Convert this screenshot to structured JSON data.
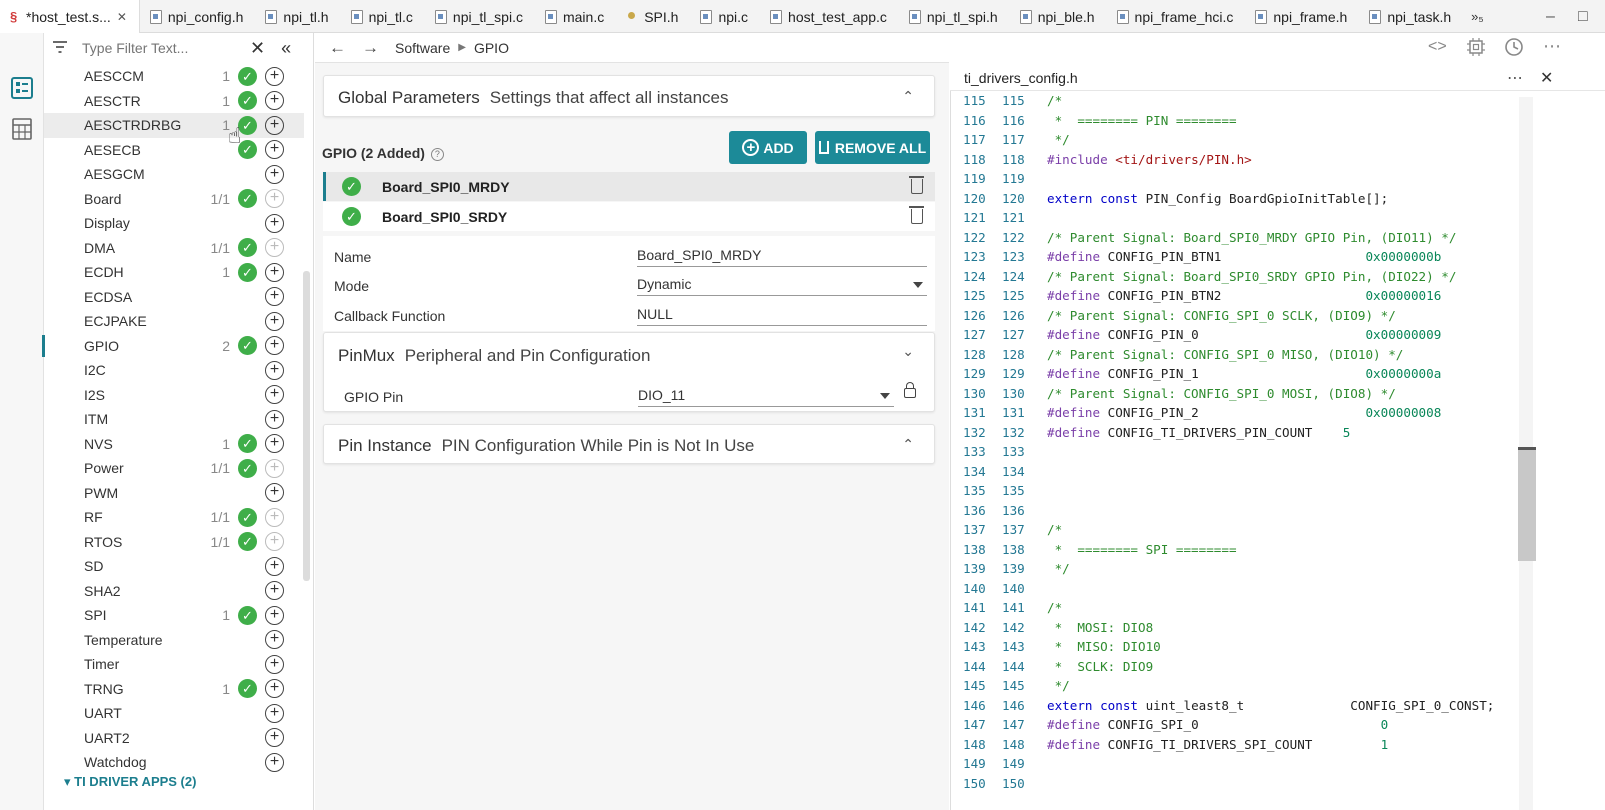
{
  "tabs": [
    {
      "label": "*host_test.s...",
      "icon": "sysconfig-icon",
      "active": true
    },
    {
      "label": "npi_config.h"
    },
    {
      "label": "npi_tl.h"
    },
    {
      "label": "npi_tl.c"
    },
    {
      "label": "npi_tl_spi.c"
    },
    {
      "label": "main.c"
    },
    {
      "label": "SPI.h"
    },
    {
      "label": "npi.c"
    },
    {
      "label": "host_test_app.c"
    },
    {
      "label": "npi_tl_spi.h"
    },
    {
      "label": "npi_ble.h"
    },
    {
      "label": "npi_frame_hci.c"
    },
    {
      "label": "npi_frame.h"
    },
    {
      "label": "npi_task.h"
    }
  ],
  "tab_overflow": "»₅",
  "filter": {
    "placeholder": "Type Filter Text..."
  },
  "modules": [
    {
      "name": "AESCCM",
      "count": "1",
      "added": true
    },
    {
      "name": "AESCTR",
      "count": "1",
      "added": true
    },
    {
      "name": "AESCTRDRBG",
      "count": "1",
      "added": true,
      "highlight": true
    },
    {
      "name": "AESECB",
      "count": "",
      "added": true
    },
    {
      "name": "AESGCM",
      "count": "",
      "added": false
    },
    {
      "name": "Board",
      "count": "1/1",
      "added": true,
      "plus_dim": true
    },
    {
      "name": "Display",
      "count": "",
      "added": false
    },
    {
      "name": "DMA",
      "count": "1/1",
      "added": true,
      "plus_dim": true
    },
    {
      "name": "ECDH",
      "count": "1",
      "added": true
    },
    {
      "name": "ECDSA",
      "count": "",
      "added": false
    },
    {
      "name": "ECJPAKE",
      "count": "",
      "added": false
    },
    {
      "name": "GPIO",
      "count": "2",
      "added": true,
      "selected": true
    },
    {
      "name": "I2C",
      "count": "",
      "added": false
    },
    {
      "name": "I2S",
      "count": "",
      "added": false
    },
    {
      "name": "ITM",
      "count": "",
      "added": false
    },
    {
      "name": "NVS",
      "count": "1",
      "added": true
    },
    {
      "name": "Power",
      "count": "1/1",
      "added": true,
      "plus_dim": true
    },
    {
      "name": "PWM",
      "count": "",
      "added": false
    },
    {
      "name": "RF",
      "count": "1/1",
      "added": true,
      "plus_dim": true
    },
    {
      "name": "RTOS",
      "count": "1/1",
      "added": true,
      "plus_dim": true
    },
    {
      "name": "SD",
      "count": "",
      "added": false
    },
    {
      "name": "SHA2",
      "count": "",
      "added": false
    },
    {
      "name": "SPI",
      "count": "1",
      "added": true
    },
    {
      "name": "Temperature",
      "count": "",
      "added": false
    },
    {
      "name": "Timer",
      "count": "",
      "added": false
    },
    {
      "name": "TRNG",
      "count": "1",
      "added": true
    },
    {
      "name": "UART",
      "count": "",
      "added": false
    },
    {
      "name": "UART2",
      "count": "",
      "added": false
    },
    {
      "name": "Watchdog",
      "count": "",
      "added": false
    }
  ],
  "module_section": "▾  TI DRIVER APPS (2)",
  "breadcrumb": {
    "root": "Software",
    "current": "GPIO"
  },
  "global_params": {
    "title": "Global Parameters",
    "subtitle": "Settings that affect all instances"
  },
  "gpio": {
    "header": "GPIO (2 Added)",
    "add_label": "ADD",
    "remove_all_label": "REMOVE ALL",
    "instances": [
      "Board_SPI0_MRDY",
      "Board_SPI0_SRDY"
    ]
  },
  "props": [
    {
      "label": "Name",
      "value": "Board_SPI0_MRDY",
      "dropdown": false
    },
    {
      "label": "Mode",
      "value": "Dynamic",
      "dropdown": true
    },
    {
      "label": "Callback Function",
      "value": "NULL",
      "dropdown": false
    }
  ],
  "pinmux": {
    "title": "PinMux",
    "subtitle": "Peripheral and Pin Configuration",
    "pin_label": "GPIO Pin",
    "pin_value": "DIO_11"
  },
  "pin_instance": {
    "title": "Pin Instance",
    "subtitle": "PIN Configuration While Pin is Not In Use"
  },
  "editor": {
    "title": "ti_drivers_config.h",
    "lines": [
      {
        "n": "115",
        "t": "/*",
        "k": "com"
      },
      {
        "n": "116",
        "t": " *  ======== PIN ========",
        "k": "com"
      },
      {
        "n": "117",
        "t": " */",
        "k": "com"
      },
      {
        "n": "118",
        "t": "#include <ti/drivers/PIN.h>",
        "k": "inc"
      },
      {
        "n": "119",
        "t": "",
        "k": "plain"
      },
      {
        "n": "120",
        "t": "extern const PIN_Config BoardGpioInitTable[];",
        "k": "ext"
      },
      {
        "n": "121",
        "t": "",
        "k": "plain"
      },
      {
        "n": "122",
        "t": "/* Parent Signal: Board_SPI0_MRDY GPIO Pin, (DIO11) */",
        "k": "com"
      },
      {
        "n": "123",
        "t": "#define CONFIG_PIN_BTN1                   0x0000000b",
        "k": "def"
      },
      {
        "n": "124",
        "t": "/* Parent Signal: Board_SPI0_SRDY GPIO Pin, (DIO22) */",
        "k": "com"
      },
      {
        "n": "125",
        "t": "#define CONFIG_PIN_BTN2                   0x00000016",
        "k": "def"
      },
      {
        "n": "126",
        "t": "/* Parent Signal: CONFIG_SPI_0 SCLK, (DIO9) */",
        "k": "com"
      },
      {
        "n": "127",
        "t": "#define CONFIG_PIN_0                      0x00000009",
        "k": "def"
      },
      {
        "n": "128",
        "t": "/* Parent Signal: CONFIG_SPI_0 MISO, (DIO10) */",
        "k": "com"
      },
      {
        "n": "129",
        "t": "#define CONFIG_PIN_1                      0x0000000a",
        "k": "def"
      },
      {
        "n": "130",
        "t": "/* Parent Signal: CONFIG_SPI_0 MOSI, (DIO8) */",
        "k": "com"
      },
      {
        "n": "131",
        "t": "#define CONFIG_PIN_2                      0x00000008",
        "k": "def"
      },
      {
        "n": "132",
        "t": "#define CONFIG_TI_DRIVERS_PIN_COUNT    5",
        "k": "def"
      },
      {
        "n": "133",
        "t": "",
        "k": "plain"
      },
      {
        "n": "134",
        "t": "",
        "k": "plain"
      },
      {
        "n": "135",
        "t": "",
        "k": "plain"
      },
      {
        "n": "136",
        "t": "",
        "k": "plain"
      },
      {
        "n": "137",
        "t": "/*",
        "k": "com"
      },
      {
        "n": "138",
        "t": " *  ======== SPI ========",
        "k": "com"
      },
      {
        "n": "139",
        "t": " */",
        "k": "com"
      },
      {
        "n": "140",
        "t": "",
        "k": "plain"
      },
      {
        "n": "141",
        "t": "/*",
        "k": "com"
      },
      {
        "n": "142",
        "t": " *  MOSI: DIO8",
        "k": "com"
      },
      {
        "n": "143",
        "t": " *  MISO: DIO10",
        "k": "com"
      },
      {
        "n": "144",
        "t": " *  SCLK: DIO9",
        "k": "com"
      },
      {
        "n": "145",
        "t": " */",
        "k": "com"
      },
      {
        "n": "146",
        "t": "extern const uint_least8_t              CONFIG_SPI_0_CONST;",
        "k": "ext"
      },
      {
        "n": "147",
        "t": "#define CONFIG_SPI_0                        0",
        "k": "def"
      },
      {
        "n": "148",
        "t": "#define CONFIG_TI_DRIVERS_SPI_COUNT         1",
        "k": "def"
      },
      {
        "n": "149",
        "t": "",
        "k": "plain"
      },
      {
        "n": "150",
        "t": "",
        "k": "plain"
      }
    ]
  },
  "colors": {
    "accent": "#1c8a98",
    "check": "#3fae49"
  }
}
